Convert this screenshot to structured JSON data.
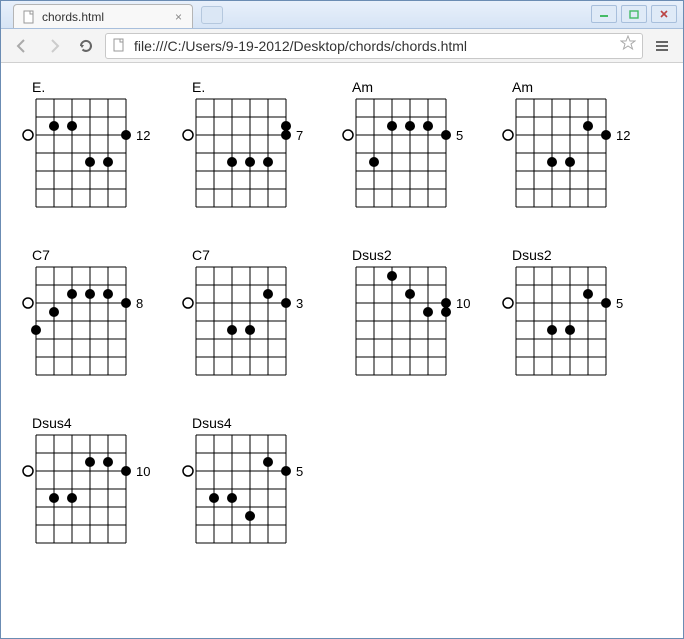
{
  "window": {
    "tab_title": "chords.html",
    "url": "file:///C:/Users/9-19-2012/Desktop/chords/chords.html"
  },
  "fretboard": {
    "strings": 6,
    "frets": 6
  },
  "chords": [
    {
      "name": "E.",
      "label": "12",
      "open": [
        0
      ],
      "dots": [
        [
          3,
          2
        ],
        [
          4,
          2
        ],
        [
          2,
          4
        ],
        [
          1,
          4
        ]
      ]
    },
    {
      "name": "E.",
      "label": "7",
      "open": [
        0
      ],
      "dots": [
        [
          3,
          4
        ],
        [
          2,
          4
        ],
        [
          1,
          4
        ],
        [
          0,
          2
        ]
      ]
    },
    {
      "name": "Am",
      "label": "5",
      "open": [
        0
      ],
      "dots": [
        [
          3,
          2
        ],
        [
          2,
          2
        ],
        [
          1,
          2
        ],
        [
          4,
          4
        ]
      ]
    },
    {
      "name": "Am",
      "label": "12",
      "open": [
        0
      ],
      "dots": [
        [
          3,
          4
        ],
        [
          2,
          4
        ],
        [
          1,
          2
        ]
      ]
    },
    {
      "name": "C7",
      "label": "8",
      "open": [
        0
      ],
      "dots": [
        [
          3,
          2
        ],
        [
          2,
          2
        ],
        [
          1,
          2
        ],
        [
          4,
          3
        ],
        [
          5,
          4
        ]
      ]
    },
    {
      "name": "C7",
      "label": "3",
      "open": [
        0
      ],
      "dots": [
        [
          3,
          4
        ],
        [
          2,
          4
        ],
        [
          1,
          2
        ]
      ]
    },
    {
      "name": "Dsus2",
      "label": "10",
      "open": [],
      "dots": [
        [
          3,
          1
        ],
        [
          2,
          2
        ],
        [
          1,
          3
        ],
        [
          0,
          3
        ]
      ]
    },
    {
      "name": "Dsus2",
      "label": "5",
      "open": [
        0
      ],
      "dots": [
        [
          3,
          4
        ],
        [
          2,
          4
        ],
        [
          1,
          2
        ]
      ]
    },
    {
      "name": "Dsus4",
      "label": "10",
      "open": [
        0
      ],
      "dots": [
        [
          2,
          2
        ],
        [
          1,
          2
        ],
        [
          4,
          4
        ],
        [
          3,
          4
        ]
      ]
    },
    {
      "name": "Dsus4",
      "label": "5",
      "open": [
        0
      ],
      "dots": [
        [
          3,
          4
        ],
        [
          1,
          2
        ],
        [
          2,
          5
        ],
        [
          4,
          4
        ]
      ]
    }
  ]
}
